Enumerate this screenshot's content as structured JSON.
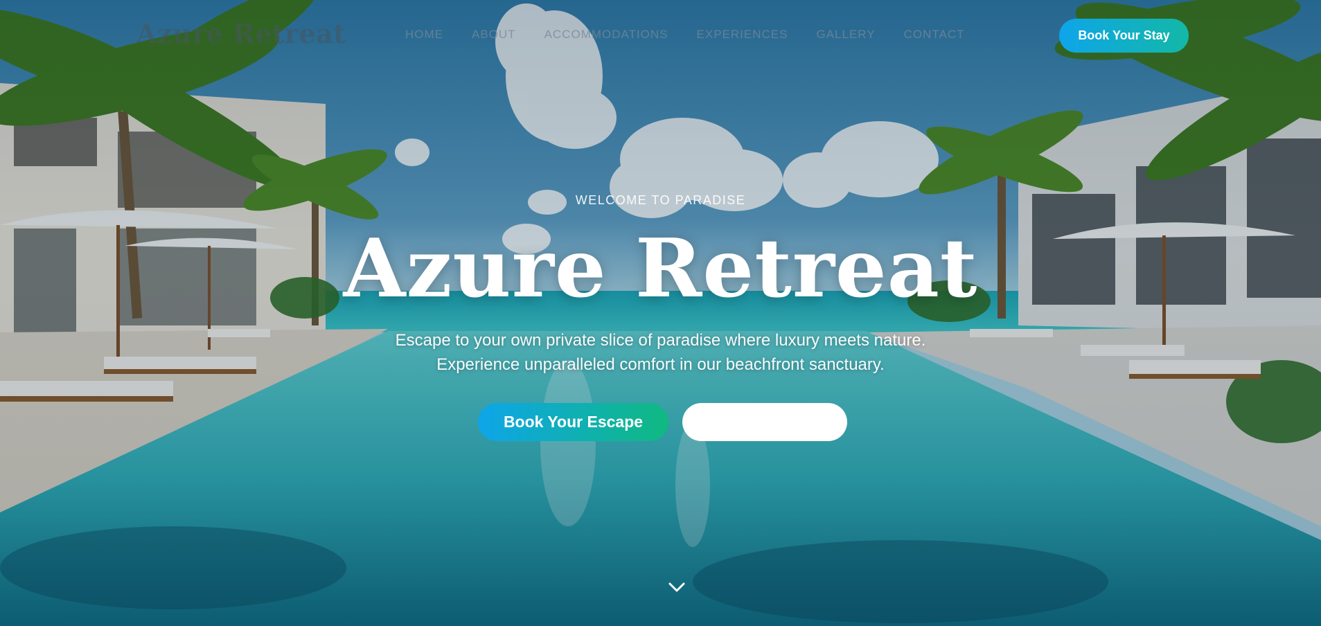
{
  "header": {
    "logo": "Azure Retreat",
    "nav": [
      {
        "label": "HOME"
      },
      {
        "label": "ABOUT"
      },
      {
        "label": "ACCOMMODATIONS"
      },
      {
        "label": "EXPERIENCES"
      },
      {
        "label": "GALLERY"
      },
      {
        "label": "CONTACT"
      }
    ],
    "cta_label": "Book Your Stay"
  },
  "hero": {
    "eyebrow": "WELCOME TO PARADISE",
    "title": "Azure Retreat",
    "subtitle_line1": "Escape to your own private slice of paradise where luxury meets nature.",
    "subtitle_line2": "Experience unparalleled comfort in our beachfront sanctuary.",
    "primary_button": "Book Your Escape",
    "secondary_button": "",
    "scroll_icon": "chevron-down-icon"
  },
  "colors": {
    "accent_start": "#0ea5e9",
    "accent_end": "#10b981",
    "title": "#ffffff"
  }
}
